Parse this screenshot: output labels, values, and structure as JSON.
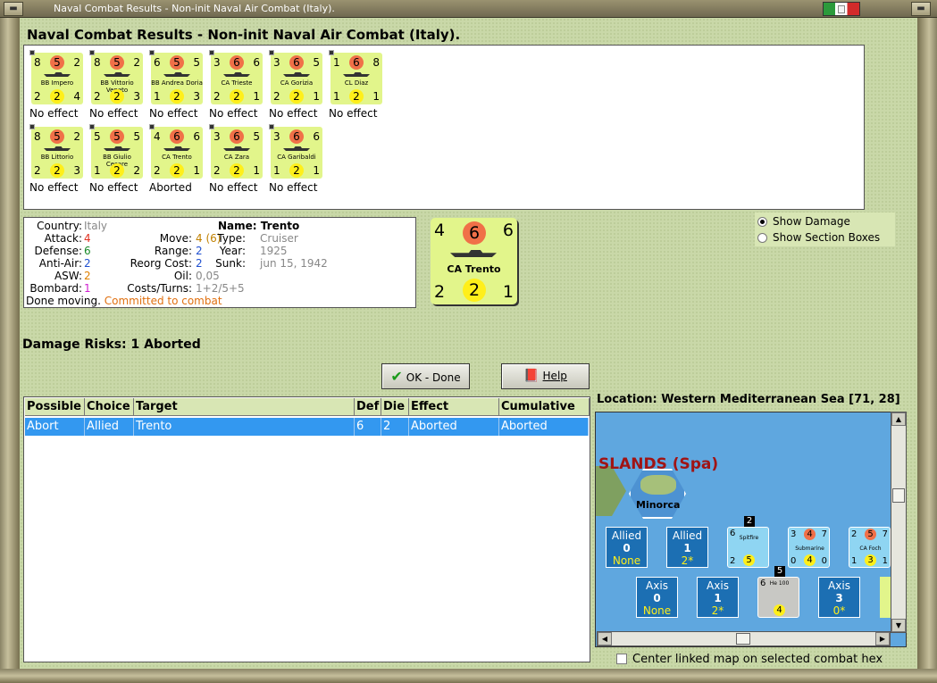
{
  "window": {
    "title": "Naval Combat Results - Non-init Naval Air Combat (Italy).",
    "heading": "Naval Combat Results - Non-init Naval Air Combat (Italy)."
  },
  "units": [
    {
      "name": "BB Impero",
      "tl": "8",
      "circle": "5",
      "tr": "2",
      "bl": "2",
      "yellow": "2",
      "br": "4",
      "result": "No effect"
    },
    {
      "name": "BB Vittorio Veneto",
      "tl": "8",
      "circle": "5",
      "tr": "2",
      "bl": "2",
      "yellow": "2",
      "br": "3",
      "result": "No effect"
    },
    {
      "name": "BB Andrea Doria",
      "tl": "6",
      "circle": "5",
      "tr": "5",
      "bl": "1",
      "yellow": "2",
      "br": "3",
      "result": "No effect"
    },
    {
      "name": "CA Trieste",
      "tl": "3",
      "circle": "6",
      "tr": "6",
      "bl": "2",
      "yellow": "2",
      "br": "1",
      "result": "No effect"
    },
    {
      "name": "CA Gorizia",
      "tl": "3",
      "circle": "6",
      "tr": "5",
      "bl": "2",
      "yellow": "2",
      "br": "1",
      "result": "No effect"
    },
    {
      "name": "CL Diaz",
      "tl": "1",
      "circle": "6",
      "tr": "8",
      "bl": "1",
      "yellow": "2",
      "br": "1",
      "result": "No effect"
    },
    {
      "name": "BB Littorio",
      "tl": "8",
      "circle": "5",
      "tr": "2",
      "bl": "2",
      "yellow": "2",
      "br": "3",
      "result": "No effect"
    },
    {
      "name": "BB Giulio Cesare",
      "tl": "5",
      "circle": "5",
      "tr": "5",
      "bl": "1",
      "yellow": "2",
      "br": "2",
      "result": "No effect"
    },
    {
      "name": "CA Trento",
      "tl": "4",
      "circle": "6",
      "tr": "6",
      "bl": "2",
      "yellow": "2",
      "br": "1",
      "result": "Aborted"
    },
    {
      "name": "CA Zara",
      "tl": "3",
      "circle": "6",
      "tr": "5",
      "bl": "2",
      "yellow": "2",
      "br": "1",
      "result": "No effect"
    },
    {
      "name": "CA Garibaldi",
      "tl": "3",
      "circle": "6",
      "tr": "6",
      "bl": "1",
      "yellow": "2",
      "br": "1",
      "result": "No effect"
    }
  ],
  "info": {
    "country_label": "Country:",
    "country": "Italy",
    "attack_label": "Attack:",
    "attack": "4",
    "defense_label": "Defense:",
    "defense": "6",
    "antiair_label": "Anti-Air:",
    "antiair": "2",
    "asw_label": "ASW:",
    "asw": "2",
    "bombard_label": "Bombard:",
    "bombard": "1",
    "status": "Done moving.",
    "status_combat": "Committed to combat",
    "name_label": "Name:",
    "name": "Trento",
    "move_label": "Move:",
    "move": "4",
    "move_extra": "(6)",
    "range_label": "Range:",
    "range": "2",
    "reorg_label": "Reorg Cost:",
    "reorg": "2",
    "oil_label": "Oil:",
    "oil": "0,05",
    "costs_label": "Costs/Turns:",
    "costs": "1+2/5+5",
    "type_label": "Type:",
    "type": "Cruiser",
    "year_label": "Year:",
    "year": "1925",
    "sunk_label": "Sunk:",
    "sunk": "jun 15, 1942"
  },
  "selected_counter": {
    "name": "CA Trento",
    "tl": "4",
    "circle": "6",
    "tr": "6",
    "bl": "2",
    "yellow": "2",
    "br": "1"
  },
  "options": {
    "show_damage": "Show Damage",
    "show_section_boxes": "Show Section Boxes",
    "selected": "show_damage"
  },
  "damage_risks": "Damage Risks:  1 Aborted",
  "buttons": {
    "ok": "OK - Done",
    "help": "Help"
  },
  "table": {
    "columns": [
      "Possible",
      "Choice",
      "Target",
      "Def",
      "Die",
      "Effect",
      "Cumulative"
    ],
    "rows": [
      [
        "Abort",
        "Allied",
        "Trento",
        "6",
        "2",
        "Aborted",
        "Aborted"
      ]
    ]
  },
  "location": "Location:  Western Mediterranean Sea [71, 28]",
  "map": {
    "region_label": "SLANDS (Spa)",
    "island": "Minorca",
    "allied_boxes": [
      {
        "label": "Allied",
        "count": "0",
        "sub": "None"
      },
      {
        "label": "Allied",
        "count": "1",
        "sub": "2*"
      }
    ],
    "axis_boxes": [
      {
        "label": "Axis",
        "count": "0",
        "sub": "None"
      },
      {
        "label": "Axis",
        "count": "1",
        "sub": "2*"
      },
      {
        "label": "Axis",
        "count": "3",
        "sub": "0*"
      }
    ],
    "allied_units": [
      {
        "name": "Spitfire",
        "tl": "6",
        "tr": "",
        "bl": "2",
        "yellow": "5",
        "br": "",
        "stack": "2"
      },
      {
        "name": "Submarine",
        "tl": "3",
        "circle": "4",
        "tr": "7",
        "bl": "0",
        "yellow": "4",
        "br": "0"
      },
      {
        "name": "CA Foch",
        "tl": "2",
        "circle": "5",
        "tr": "7",
        "bl": "1",
        "yellow": "3",
        "br": "1"
      }
    ],
    "axis_units": [
      {
        "name": "He 100",
        "tl": "6",
        "yellow": "4",
        "stack": "5"
      }
    ]
  },
  "center_map_label": "Center linked map on selected combat hex",
  "colors": {
    "counter_axis": "#e2f58b",
    "counter_allied": "#8fd5f2",
    "selected_row": "#3398f0",
    "attack_red": "#e03020",
    "defense_green": "#1a8a2a",
    "antiair_blue": "#2050d0",
    "asw_orange": "#e08000",
    "bombard_magenta": "#d020d0",
    "combat_orange": "#e07010"
  }
}
